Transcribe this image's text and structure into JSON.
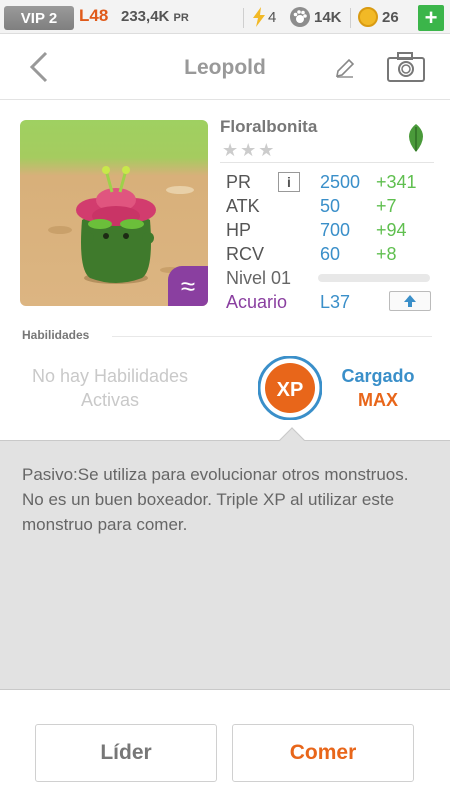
{
  "status": {
    "vip": "VIP 2",
    "level": "L48",
    "pr_value": "233,4K",
    "pr_unit": "PR",
    "energy": "4",
    "paw_count": "14K",
    "coins": "26",
    "plus_label": "+"
  },
  "header": {
    "back_label": "<",
    "title": "Leopold"
  },
  "monster": {
    "name": "Floralbonita",
    "stars": "★★★",
    "element_symbol": "≈",
    "stats": [
      {
        "label": "PR",
        "value": "2500",
        "bonus": "+341"
      },
      {
        "label": "ATK",
        "value": "50",
        "bonus": "+7"
      },
      {
        "label": "HP",
        "value": "700",
        "bonus": "+94"
      },
      {
        "label": "RCV",
        "value": "60",
        "bonus": "+8"
      }
    ],
    "info_label": "i",
    "level_label": "Nivel 01",
    "level_progress": 0,
    "type": "Acuario",
    "type_level": "L37"
  },
  "skills": {
    "heading": "Habilidades",
    "none_text": "No hay Habilidades Activas",
    "xp_label": "XP",
    "charged": "Cargado",
    "max": "MAX"
  },
  "description": "Pasivo:Se utiliza para evolucionar otros monstruos. No es un buen boxeador. Triple XP al utilizar este monstruo para comer.",
  "actions": {
    "leader": "Líder",
    "eat": "Comer"
  },
  "colors": {
    "accent_blue": "#3a8fc9",
    "accent_orange": "#e8661a",
    "bonus_green": "#5fbf4f",
    "element_purple": "#8a3fa0"
  }
}
